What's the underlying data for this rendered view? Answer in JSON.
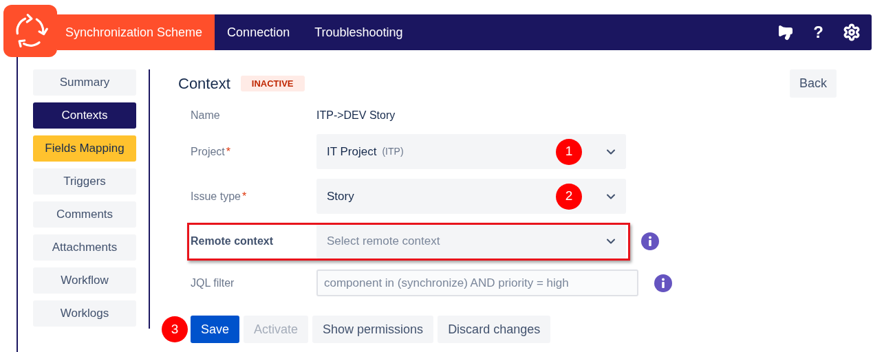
{
  "header": {
    "tabs": [
      {
        "label": "Synchronization Scheme",
        "selected": true
      },
      {
        "label": "Connection",
        "selected": false
      },
      {
        "label": "Troubleshooting",
        "selected": false
      }
    ],
    "help": "?"
  },
  "sidebar": {
    "items": [
      {
        "label": "Summary",
        "selected": false,
        "highlighted": false
      },
      {
        "label": "Contexts",
        "selected": true,
        "highlighted": false
      },
      {
        "label": "Fields Mapping",
        "selected": false,
        "highlighted": true
      },
      {
        "label": "Triggers",
        "selected": false,
        "highlighted": false
      },
      {
        "label": "Comments",
        "selected": false,
        "highlighted": false
      },
      {
        "label": "Attachments",
        "selected": false,
        "highlighted": false
      },
      {
        "label": "Workflow",
        "selected": false,
        "highlighted": false
      },
      {
        "label": "Worklogs",
        "selected": false,
        "highlighted": false
      }
    ]
  },
  "context": {
    "title": "Context",
    "status": "INACTIVE",
    "back": "Back",
    "fields": [
      {
        "kind": "text",
        "label": "Name",
        "value": "ITP->DEV Story"
      },
      {
        "kind": "select",
        "label": "Project",
        "asterisk": "*",
        "value": "IT Project",
        "suffix": "(ITP)",
        "marker": "1",
        "highlighted": false,
        "info": false
      },
      {
        "kind": "select",
        "label": "Issue type",
        "asterisk": "*",
        "value": "Story",
        "marker": "2",
        "highlighted": false,
        "info": false
      },
      {
        "kind": "select",
        "label": "Remote context",
        "placeholder": "Select remote context",
        "highlighted": true,
        "info": true
      },
      {
        "kind": "input",
        "label": "JQL filter",
        "placeholder": "component in (synchronize) AND priority = high",
        "info": true
      }
    ],
    "marker": "3",
    "buttons": [
      {
        "label": "Save",
        "kind": "primary",
        "disabled": false
      },
      {
        "label": "Activate",
        "kind": "default",
        "disabled": true
      },
      {
        "label": "Show permissions",
        "kind": "default",
        "disabled": false
      },
      {
        "label": "Discard changes",
        "kind": "default",
        "disabled": false
      }
    ]
  }
}
